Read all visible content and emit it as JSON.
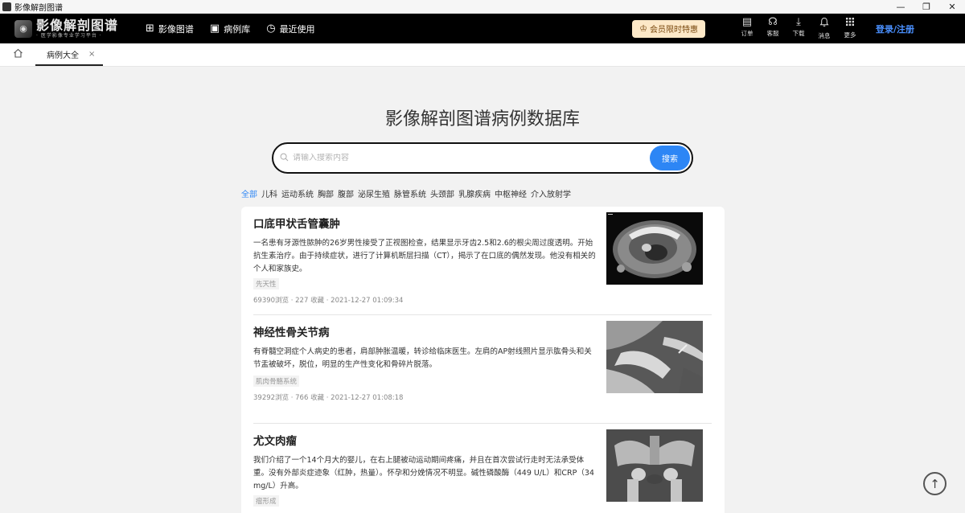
{
  "window": {
    "title": "影像解剖图谱",
    "minimize": "—",
    "restore": "❐",
    "close": "✕"
  },
  "nav": {
    "logo_main": "影像解剖图谱",
    "logo_sub": "· 医学影像专业学习平台 ·",
    "logo_icon": "brain-logo-icon",
    "items": [
      {
        "icon": "grid-icon",
        "glyph": "⊞",
        "label": "影像图谱"
      },
      {
        "icon": "book-icon",
        "glyph": "▣",
        "label": "病例库"
      },
      {
        "icon": "history-icon",
        "glyph": "◷",
        "label": "最近使用"
      }
    ],
    "vip": {
      "icon": "crown-icon",
      "glyph": "♔",
      "label": "会员限时特惠"
    },
    "tools": [
      {
        "icon": "order-icon",
        "glyph": "▤",
        "label": "订单"
      },
      {
        "icon": "headset-icon",
        "glyph": "☊",
        "label": "客服"
      },
      {
        "icon": "download-icon",
        "glyph": "⤓",
        "label": "下载"
      },
      {
        "icon": "bell-icon",
        "glyph": "♫",
        "label": "消息"
      },
      {
        "icon": "apps-icon",
        "glyph": "⁙",
        "label": "更多"
      }
    ],
    "login": "登录/注册"
  },
  "tabs": {
    "home_icon": "home-icon",
    "active": {
      "label": "病例大全",
      "close": "×"
    }
  },
  "page": {
    "title": "影像解剖图谱病例数据库",
    "search": {
      "placeholder": "请输入搜索内容",
      "button": "搜索"
    },
    "categories": [
      "全部",
      "儿科",
      "运动系统",
      "胸部",
      "腹部",
      "泌尿生殖",
      "脉管系统",
      "头颈部",
      "乳腺疾病",
      "中枢神经",
      "介入放射学"
    ],
    "active_category": "全部",
    "accent_color": "#2d86f5",
    "cases": [
      {
        "title": "口底甲状舌管囊肿",
        "desc": "一名患有牙源性脓肿的26岁男性接受了正视图检查，结果显示牙齿2.5和2.6的根尖周过度透明。开始抗生素治疗。由于持续症状，进行了计算机断层扫描（CT），揭示了在口底的偶然发现。他没有相关的个人和家族史。",
        "tag": "先天性",
        "meta": "69390浏览 · 227 收藏 · 2021-12-27 01:09:34",
        "image": "ct-neck-image"
      },
      {
        "title": "神经性骨关节病",
        "desc": "有脊髓空洞症个人病史的患者，肩部肿胀温暖，转诊给临床医生。左肩的AP射线照片显示肱骨头和关节盂被破坏，脱位，明显的生产性变化和骨碎片脱落。",
        "tag": "肌肉骨骼系统",
        "meta": "39292浏览 · 766 收藏 · 2021-12-27 01:08:18",
        "image": "xray-shoulder-image"
      },
      {
        "title": "尤文肉瘤",
        "desc": "我们介绍了一个14个月大的婴儿，在右上腿被动运动期间疼痛，并且在首次尝试行走时无法承受体重。没有外部炎症迹象（红肿，热量）。怀孕和分娩情况不明显。碱性磷酸酶（449 U/L）和CRP（34 mg/L）升高。",
        "tag": "瘤形成",
        "meta": "",
        "image": "xray-pelvis-image"
      }
    ],
    "back_to_top_icon": "arrow-up-icon",
    "back_to_top_glyph": "↑"
  }
}
